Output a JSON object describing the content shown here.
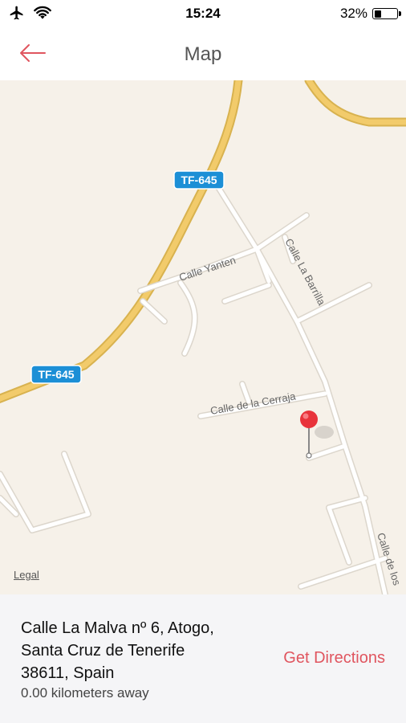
{
  "status": {
    "time": "15:24",
    "battery": "32%",
    "battery_level": 0.32,
    "icons": [
      "airplane-icon",
      "wifi-icon",
      "battery-icon"
    ]
  },
  "nav": {
    "title": "Map",
    "back_icon": "arrow-left-icon"
  },
  "map": {
    "road_shields": [
      "TF-645",
      "TF-645"
    ],
    "street_labels": [
      "Calle Yanten",
      "Calle La Barrilla",
      "Calle de la Cerraja",
      "Calle de los"
    ],
    "legal": "Legal",
    "pin_icon": "map-pin-icon"
  },
  "location": {
    "address_line1": "Calle La Malva nº 6, Atogo,",
    "address_line2": "Santa Cruz de Tenerife",
    "address_line3": "38611, Spain",
    "distance": "0.00 kilometers away",
    "directions_label": "Get Directions"
  },
  "colors": {
    "accent": "#e0555f",
    "map_bg": "#f6f1e9",
    "highway": "#f2cb6b",
    "street": "#ffffff",
    "shield": "#1c8fd6",
    "pin": "#e8333b"
  }
}
